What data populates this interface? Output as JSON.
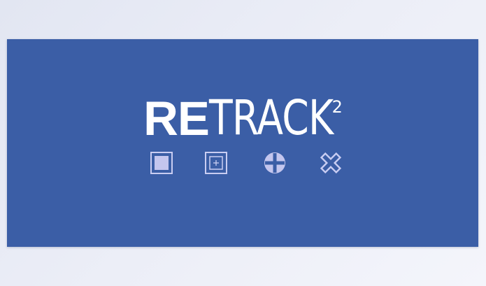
{
  "logo": {
    "part_bold": "RE",
    "part_light": "TRACK",
    "superscript": "2"
  },
  "icons": [
    {
      "name": "filled-square-icon"
    },
    {
      "name": "square-crosshair-icon"
    },
    {
      "name": "circle-cross-icon"
    },
    {
      "name": "x-cross-icon"
    }
  ],
  "colors": {
    "banner": "#3b5ea6",
    "text": "#ffffff",
    "icon_stroke": "#c9cdf2",
    "icon_fill": "#c4c6ee"
  }
}
